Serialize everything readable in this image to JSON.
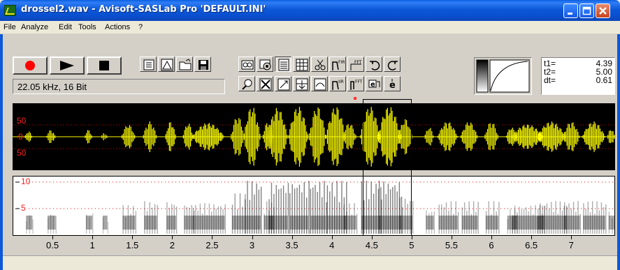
{
  "window": {
    "title": "drossel2.wav - Avisoft-SASLab Pro  'DEFAULT.INI'"
  },
  "menu": [
    "File",
    "Analyze",
    "Edit",
    "Tools",
    "Actions",
    "?"
  ],
  "transport": {
    "record_icon": "record-icon",
    "play_icon": "play-icon",
    "stop_icon": "stop-icon"
  },
  "status": {
    "format": "22.05 kHz, 16 Bit"
  },
  "cursor_readout": {
    "t1_label": "t1=",
    "t1_value": "4.39",
    "t2_label": "t2=",
    "t2_value": "5.00",
    "dt_label": "dt=",
    "dt_value": "0.61"
  },
  "waveform": {
    "labels": [
      "50",
      "0",
      "50"
    ],
    "color": "#ffff00",
    "background": "#000000"
  },
  "spectrogram": {
    "labels": [
      "10",
      "5"
    ],
    "gridline_color": "#ff0000"
  },
  "selection": {
    "start": 4.39,
    "end": 5.0
  },
  "time_axis": {
    "ticks": [
      "0.5",
      "1",
      "1.5",
      "2",
      "2.5",
      "3",
      "3.5",
      "4",
      "4.5",
      "5",
      "5.5",
      "6",
      "6.5",
      "7"
    ],
    "start": 0.0,
    "end": 7.55
  },
  "colors": {
    "titlebar": "#0c58d8",
    "record": "#ff0000",
    "wave": "#ffff00"
  }
}
